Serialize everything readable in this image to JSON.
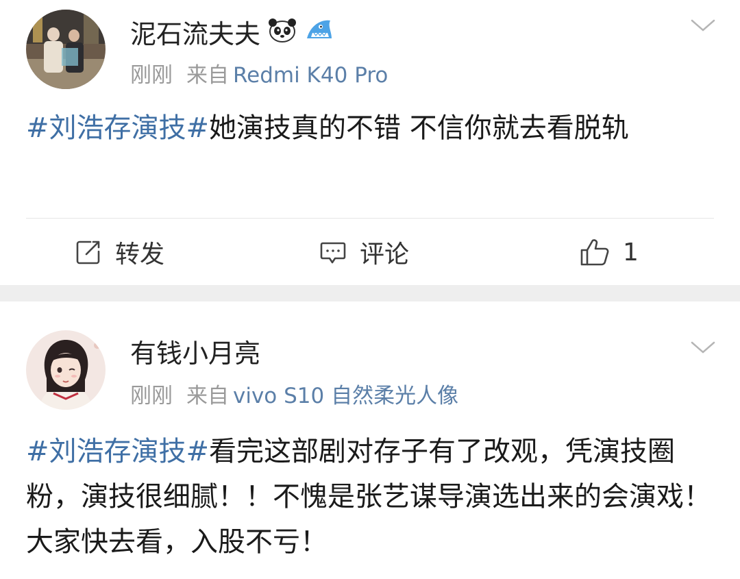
{
  "posts": [
    {
      "username": "泥石流夫夫",
      "time": "刚刚",
      "from_label": "来自",
      "device": "Redmi K40 Pro",
      "hashtag": "#刘浩存演技#",
      "text": "她演技真的不错 不信你就去看脱轨",
      "actions": {
        "repost": "转发",
        "comment": "评论",
        "like_count": "1"
      },
      "icons": [
        "panda-emoji-icon",
        "shark-emoji-icon"
      ]
    },
    {
      "username": "有钱小月亮",
      "time": "刚刚",
      "from_label": "来自",
      "device": "vivo S10 自然柔光人像",
      "hashtag": "#刘浩存演技#",
      "text": "看完这部剧对存子有了改观，凭演技圈粉，演技很细腻！！不愧是张艺谋导演选出来的会演戏！大家快去看，入股不亏！"
    }
  ],
  "colors": {
    "link": "#3f6fa5",
    "device": "#5b7fa8",
    "meta": "#9a9a9a",
    "separator_band": "#eeeeee"
  }
}
